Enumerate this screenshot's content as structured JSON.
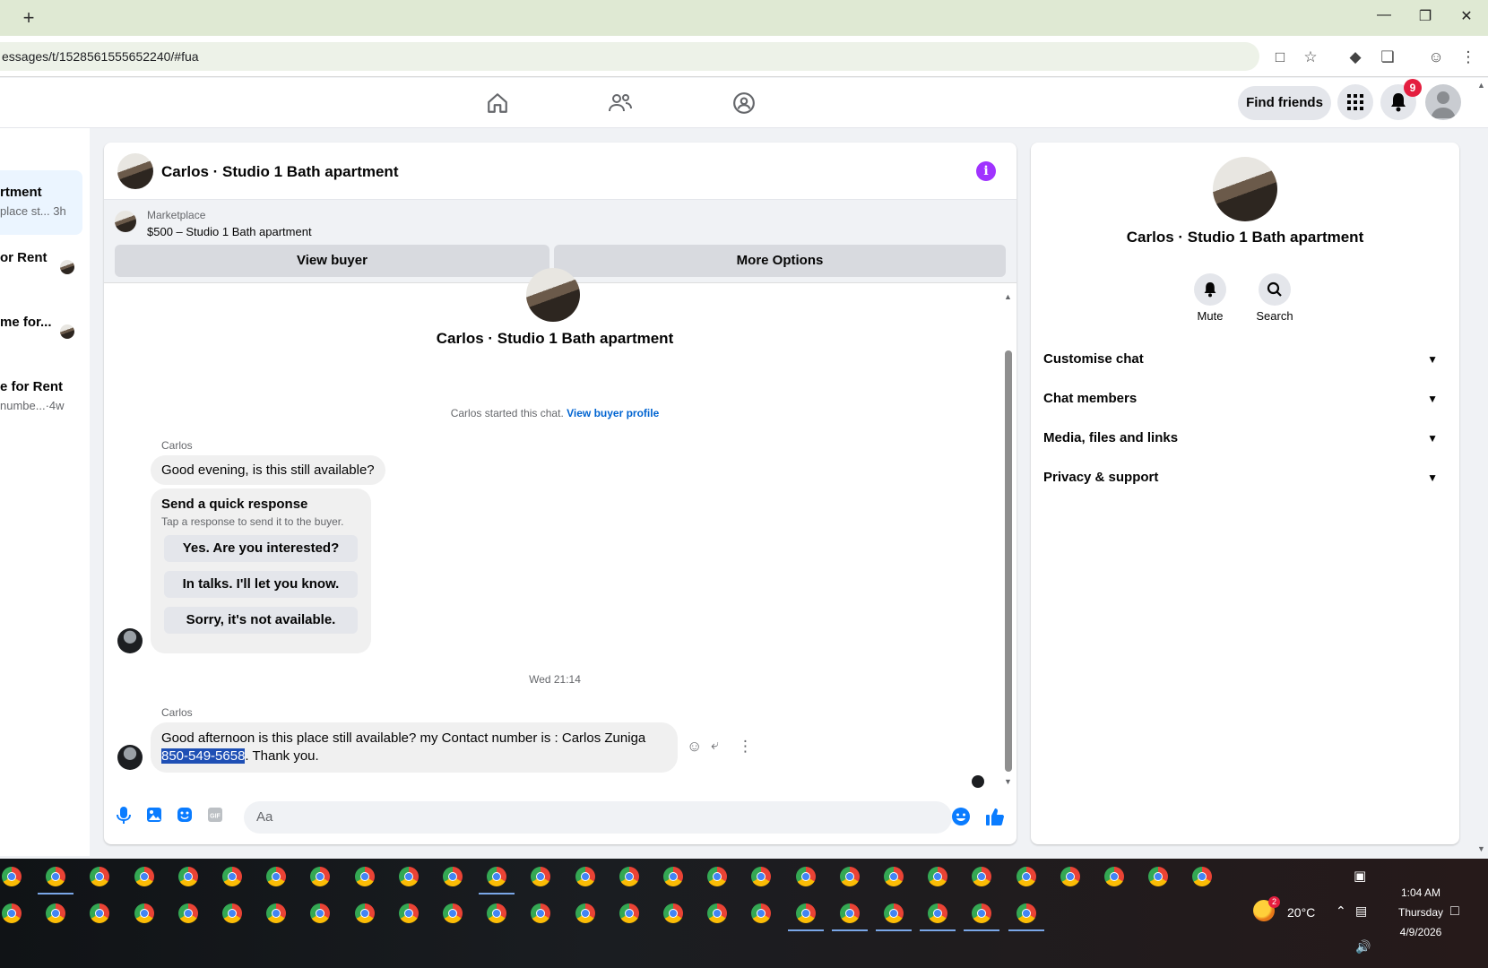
{
  "browser": {
    "url": "essages/t/1528561555652240/#fua",
    "new_tab": "+"
  },
  "fb_nav": {
    "find_friends": "Find friends",
    "notification_count": "9"
  },
  "sidebar": {
    "items": [
      {
        "title": "rtment",
        "subtitle": "place st...",
        "time": "3h"
      },
      {
        "title": "or Rent",
        "subtitle": ""
      },
      {
        "title": "me for...",
        "subtitle": ""
      },
      {
        "title": "e for Rent",
        "subtitle": "numbe...",
        "time": "·4w"
      }
    ]
  },
  "chat": {
    "title": "Carlos · Studio 1 Bath apartment",
    "marketplace_label": "Marketplace",
    "listing": "$500 – Studio 1 Bath apartment",
    "view_buyer": "View buyer",
    "more_options": "More Options",
    "intro_name": "Carlos · Studio 1 Bath apartment",
    "started_text": "Carlos started this chat.",
    "view_buyer_profile": "View buyer profile",
    "sender1": "Carlos",
    "msg1": "Good evening, is this still available?",
    "quick_title": "Send a quick response",
    "quick_sub": "Tap a response to send it to the buyer.",
    "quick_responses": [
      "Yes. Are you interested?",
      "In talks. I'll let you know.",
      "Sorry, it's not available."
    ],
    "timestamp": "Wed 21:14",
    "sender2": "Carlos",
    "msg2_line1": "Good afternoon is this place still available? my Contact number is : Carlos Zuniga",
    "msg2_phone": "850-549-5658",
    "msg2_rest": ". Thank you.",
    "composer_placeholder": "Aa"
  },
  "right_panel": {
    "name": "Carlos · Studio 1 Bath apartment",
    "mute": "Mute",
    "search": "Search",
    "sections": [
      "Customise chat",
      "Chat members",
      "Media, files and links",
      "Privacy & support"
    ]
  },
  "taskbar": {
    "weather": "20°C",
    "weather_badge": "2",
    "time": "1:04 AM",
    "day": "Thursday",
    "date": "4/9/2026"
  },
  "colors": {
    "accent": "#0a7cff",
    "info": "#a033ff",
    "badge": "#e41e3f"
  }
}
